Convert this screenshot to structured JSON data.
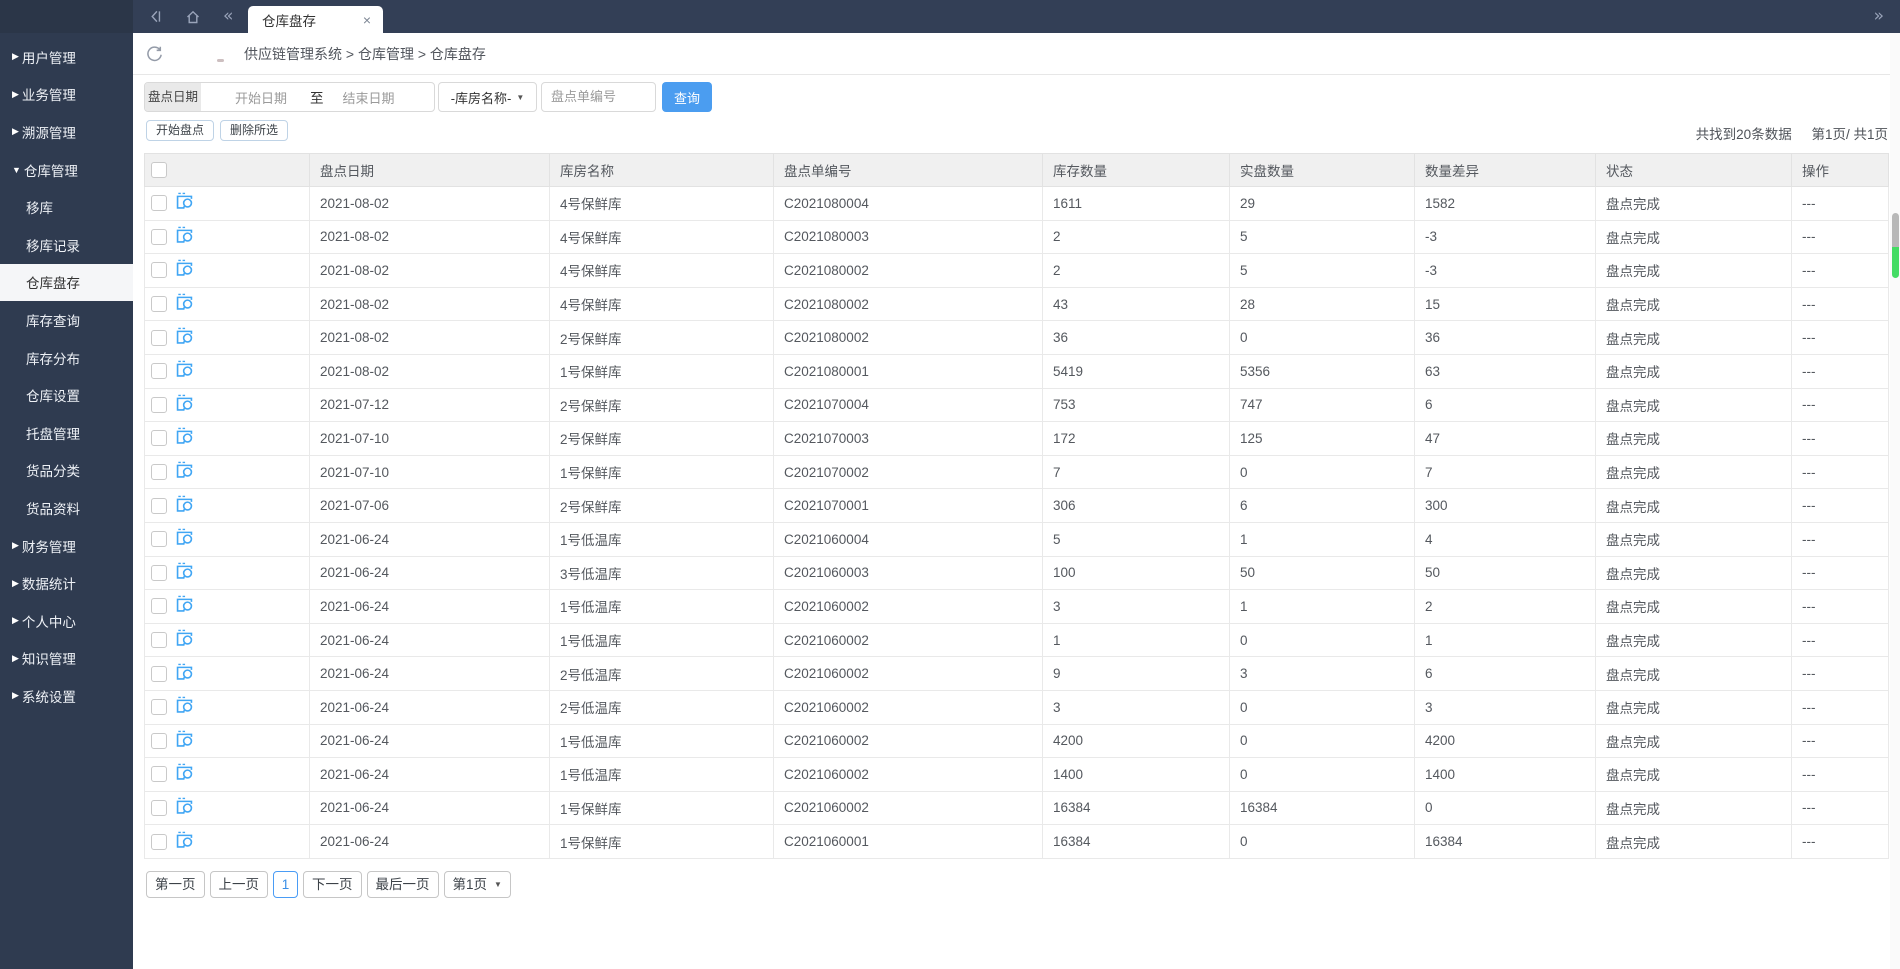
{
  "topbar": {
    "tab_title": "仓库盘存",
    "close_label": "×",
    "back_icon": "chevron-back",
    "home_icon": "home",
    "collapse_left": "«",
    "expand_right": "»"
  },
  "sidebar": {
    "items": [
      {
        "label": "用户管理",
        "type": "parent",
        "expanded": false,
        "active": false
      },
      {
        "label": "业务管理",
        "type": "parent",
        "expanded": false,
        "active": false
      },
      {
        "label": "溯源管理",
        "type": "parent",
        "expanded": false,
        "active": false
      },
      {
        "label": "仓库管理",
        "type": "parent",
        "expanded": true,
        "active": false
      },
      {
        "label": "移库",
        "type": "sub",
        "active": false
      },
      {
        "label": "移库记录",
        "type": "sub",
        "active": false
      },
      {
        "label": "仓库盘存",
        "type": "sub",
        "active": true
      },
      {
        "label": "库存查询",
        "type": "sub",
        "active": false
      },
      {
        "label": "库存分布",
        "type": "sub",
        "active": false
      },
      {
        "label": "仓库设置",
        "type": "sub",
        "active": false
      },
      {
        "label": "托盘管理",
        "type": "sub",
        "active": false
      },
      {
        "label": "货品分类",
        "type": "sub",
        "active": false
      },
      {
        "label": "货品资料",
        "type": "sub",
        "active": false
      },
      {
        "label": "财务管理",
        "type": "parent",
        "expanded": false,
        "active": false
      },
      {
        "label": "数据统计",
        "type": "parent",
        "expanded": false,
        "active": false
      },
      {
        "label": "个人中心",
        "type": "parent",
        "expanded": false,
        "active": false
      },
      {
        "label": "知识管理",
        "type": "parent",
        "expanded": false,
        "active": false
      },
      {
        "label": "系统设置",
        "type": "parent",
        "expanded": false,
        "active": false
      }
    ]
  },
  "breadcrumb": {
    "text": "供应链管理系统 > 仓库管理 > 仓库盘存"
  },
  "filters": {
    "date_label": "盘点日期",
    "start_placeholder": "开始日期",
    "to_label": "至",
    "end_placeholder": "结束日期",
    "warehouse_select_value": "-库房名称-",
    "code_placeholder": "盘点单编号",
    "search_label": "查询",
    "start_check_label": "开始盘点",
    "delete_selected_label": "删除所选"
  },
  "summary": {
    "found": "共找到20条数据",
    "page": "第1页/ 共1页"
  },
  "table": {
    "columns": [
      "盘点日期",
      "库房名称",
      "盘点单编号",
      "库存数量",
      "实盘数量",
      "数量差异",
      "状态",
      "操作"
    ],
    "rows": [
      {
        "date": "2021-08-02",
        "warehouse": "4号保鲜库",
        "code": "C2021080004",
        "stock": "1611",
        "actual": "29",
        "diff": "1582",
        "status": "盘点完成",
        "action": "---"
      },
      {
        "date": "2021-08-02",
        "warehouse": "4号保鲜库",
        "code": "C2021080003",
        "stock": "2",
        "actual": "5",
        "diff": "-3",
        "status": "盘点完成",
        "action": "---"
      },
      {
        "date": "2021-08-02",
        "warehouse": "4号保鲜库",
        "code": "C2021080002",
        "stock": "2",
        "actual": "5",
        "diff": "-3",
        "status": "盘点完成",
        "action": "---"
      },
      {
        "date": "2021-08-02",
        "warehouse": "4号保鲜库",
        "code": "C2021080002",
        "stock": "43",
        "actual": "28",
        "diff": "15",
        "status": "盘点完成",
        "action": "---"
      },
      {
        "date": "2021-08-02",
        "warehouse": "2号保鲜库",
        "code": "C2021080002",
        "stock": "36",
        "actual": "0",
        "diff": "36",
        "status": "盘点完成",
        "action": "---"
      },
      {
        "date": "2021-08-02",
        "warehouse": "1号保鲜库",
        "code": "C2021080001",
        "stock": "5419",
        "actual": "5356",
        "diff": "63",
        "status": "盘点完成",
        "action": "---"
      },
      {
        "date": "2021-07-12",
        "warehouse": "2号保鲜库",
        "code": "C2021070004",
        "stock": "753",
        "actual": "747",
        "diff": "6",
        "status": "盘点完成",
        "action": "---"
      },
      {
        "date": "2021-07-10",
        "warehouse": "2号保鲜库",
        "code": "C2021070003",
        "stock": "172",
        "actual": "125",
        "diff": "47",
        "status": "盘点完成",
        "action": "---"
      },
      {
        "date": "2021-07-10",
        "warehouse": "1号保鲜库",
        "code": "C2021070002",
        "stock": "7",
        "actual": "0",
        "diff": "7",
        "status": "盘点完成",
        "action": "---"
      },
      {
        "date": "2021-07-06",
        "warehouse": "2号保鲜库",
        "code": "C2021070001",
        "stock": "306",
        "actual": "6",
        "diff": "300",
        "status": "盘点完成",
        "action": "---"
      },
      {
        "date": "2021-06-24",
        "warehouse": "1号低温库",
        "code": "C2021060004",
        "stock": "5",
        "actual": "1",
        "diff": "4",
        "status": "盘点完成",
        "action": "---"
      },
      {
        "date": "2021-06-24",
        "warehouse": "3号低温库",
        "code": "C2021060003",
        "stock": "100",
        "actual": "50",
        "diff": "50",
        "status": "盘点完成",
        "action": "---"
      },
      {
        "date": "2021-06-24",
        "warehouse": "1号低温库",
        "code": "C2021060002",
        "stock": "3",
        "actual": "1",
        "diff": "2",
        "status": "盘点完成",
        "action": "---"
      },
      {
        "date": "2021-06-24",
        "warehouse": "1号低温库",
        "code": "C2021060002",
        "stock": "1",
        "actual": "0",
        "diff": "1",
        "status": "盘点完成",
        "action": "---"
      },
      {
        "date": "2021-06-24",
        "warehouse": "2号低温库",
        "code": "C2021060002",
        "stock": "9",
        "actual": "3",
        "diff": "6",
        "status": "盘点完成",
        "action": "---"
      },
      {
        "date": "2021-06-24",
        "warehouse": "2号低温库",
        "code": "C2021060002",
        "stock": "3",
        "actual": "0",
        "diff": "3",
        "status": "盘点完成",
        "action": "---"
      },
      {
        "date": "2021-06-24",
        "warehouse": "1号低温库",
        "code": "C2021060002",
        "stock": "4200",
        "actual": "0",
        "diff": "4200",
        "status": "盘点完成",
        "action": "---"
      },
      {
        "date": "2021-06-24",
        "warehouse": "1号低温库",
        "code": "C2021060002",
        "stock": "1400",
        "actual": "0",
        "diff": "1400",
        "status": "盘点完成",
        "action": "---"
      },
      {
        "date": "2021-06-24",
        "warehouse": "1号保鲜库",
        "code": "C2021060002",
        "stock": "16384",
        "actual": "16384",
        "diff": "0",
        "status": "盘点完成",
        "action": "---"
      },
      {
        "date": "2021-06-24",
        "warehouse": "1号保鲜库",
        "code": "C2021060001",
        "stock": "16384",
        "actual": "0",
        "diff": "16384",
        "status": "盘点完成",
        "action": "---"
      }
    ]
  },
  "pagination": {
    "first": "第一页",
    "prev": "上一页",
    "current": "1",
    "next": "下一页",
    "last": "最后一页",
    "page_select": "第1页"
  },
  "colors": {
    "sidebar_bg": "#2f3b50",
    "topbar_bg": "#333f56",
    "corner_bg": "#2b3648",
    "accent_blue": "#4b9df0",
    "icon_blue": "#41a6f4",
    "scroll_green": "#44dc64",
    "scroll_gray": "#a7a7a7"
  }
}
